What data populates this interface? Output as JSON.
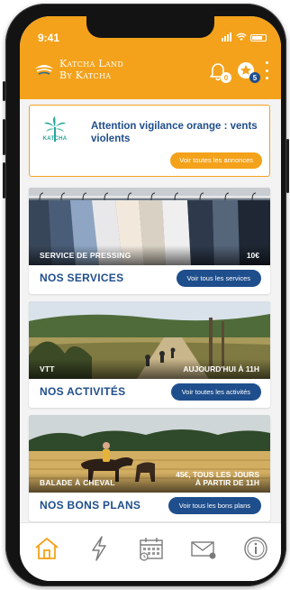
{
  "status_bar": {
    "time": "9:41"
  },
  "header": {
    "brand_line1": "Katcha Land",
    "brand_line2": "By Katcha",
    "notification_count": "0",
    "favorites_count": "5"
  },
  "alert": {
    "logo_text": "KATCHA",
    "message": "Attention vigilance orange : vents violents",
    "button_label": "Voir toutes les annonces"
  },
  "cards": [
    {
      "caption_left": "Service de pressing",
      "caption_right": "10€",
      "title": "NOS SERVICES",
      "button_label": "Voir tous les services"
    },
    {
      "caption_left": "VTT",
      "caption_right": "Aujourd'hui à 11h",
      "title": "NOS ACTIVITÉS",
      "button_label": "Voir toutes les activités"
    },
    {
      "caption_left": "Balade à cheval",
      "caption_right_line1": "45€, tous les jours",
      "caption_right_line2": "à partir de 11h",
      "title": "NOS BONS PLANS",
      "button_label": "Voir tous les bons plans"
    }
  ],
  "tab_bar": {
    "items": [
      "home-icon",
      "bolt-icon",
      "calendar-icon",
      "mail-icon",
      "info-icon"
    ],
    "active": "home-icon"
  },
  "colors": {
    "accent": "#f4a21b",
    "primary": "#1f4e8c",
    "logo_teal": "#27a69a"
  }
}
